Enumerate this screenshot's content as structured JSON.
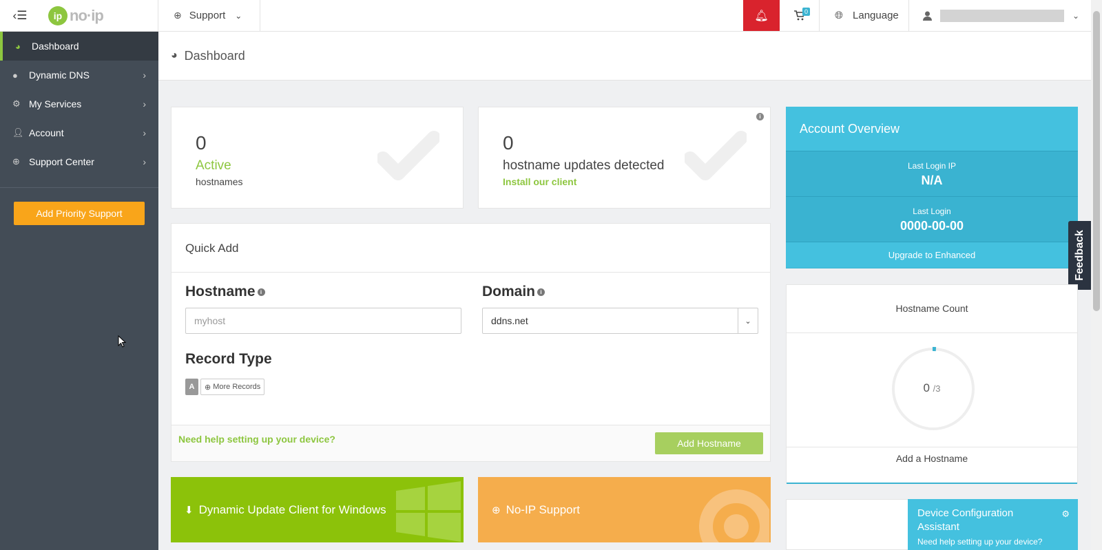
{
  "topbar": {
    "logo_text": "no·ip",
    "support_label": "Support",
    "cart_count": "0",
    "language_label": "Language"
  },
  "sidebar": {
    "items": [
      {
        "label": "Dashboard",
        "icon": "dashboard-icon"
      },
      {
        "label": "Dynamic DNS",
        "icon": "globe-icon"
      },
      {
        "label": "My Services",
        "icon": "gear-icon"
      },
      {
        "label": "Account",
        "icon": "user-icon"
      },
      {
        "label": "Support Center",
        "icon": "lifebuoy-icon"
      }
    ],
    "priority_button": "Add Priority Support"
  },
  "page": {
    "title": "Dashboard"
  },
  "stats": {
    "active": {
      "count": "0",
      "label": "Active",
      "sub": "hostnames"
    },
    "updates": {
      "count": "0",
      "label": "hostname updates detected",
      "link": "Install our client"
    }
  },
  "quick_add": {
    "title": "Quick Add",
    "hostname_label": "Hostname",
    "hostname_placeholder": "myhost",
    "domain_label": "Domain",
    "domain_value": "ddns.net",
    "record_type_label": "Record Type",
    "record_a": "A",
    "more_records": "More Records",
    "help_link": "Need help setting up your device?",
    "add_button": "Add Hostname"
  },
  "promos": {
    "windows": "Dynamic Update Client for Windows",
    "support": "No-IP Support"
  },
  "account_overview": {
    "title": "Account Overview",
    "last_login_ip_label": "Last Login IP",
    "last_login_ip": "N/A",
    "last_login_label": "Last Login",
    "last_login": "0000-00-00",
    "upgrade": "Upgrade to Enhanced"
  },
  "feedback": "Feedback",
  "hostname_count": {
    "title": "Hostname Count",
    "used": "0",
    "total": "/3",
    "fraction_used": 0,
    "add_link": "Add a Hostname"
  },
  "device_config": {
    "title": "Device Configuration Assistant",
    "subtitle": "Need help setting up your device?"
  },
  "colors": {
    "brand_green": "#8dc63f",
    "alert_red": "#d9232d",
    "accent_blue": "#3ab3d1",
    "promo_green": "#8cc20a",
    "promo_orange": "#f5ad4c",
    "priority_orange": "#f9a51a"
  }
}
